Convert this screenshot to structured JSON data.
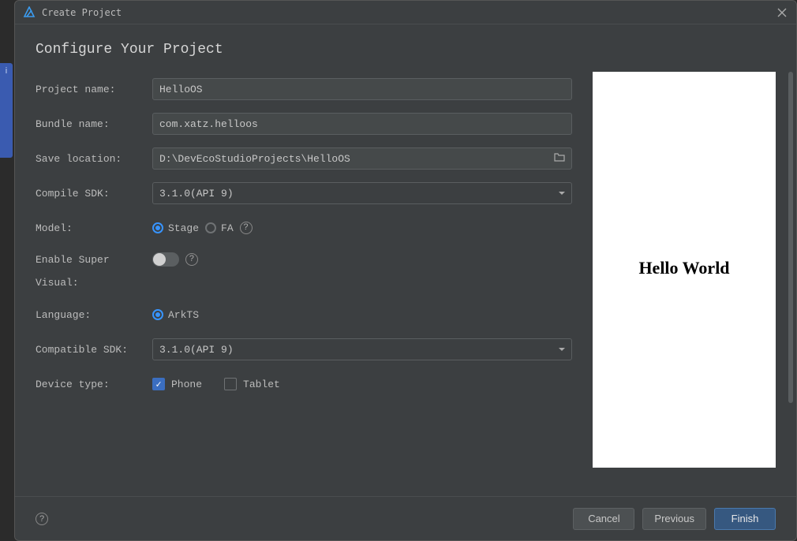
{
  "window": {
    "title": "Create Project"
  },
  "heading": "Configure Your Project",
  "form": {
    "projectName": {
      "label": "Project name:",
      "value": "HelloOS"
    },
    "bundleName": {
      "label": "Bundle name:",
      "value": "com.xatz.helloos"
    },
    "saveLocation": {
      "label": "Save location:",
      "value": "D:\\DevEcoStudioProjects\\HelloOS"
    },
    "compileSdk": {
      "label": "Compile SDK:",
      "value": "3.1.0(API 9)"
    },
    "model": {
      "label": "Model:",
      "options": [
        {
          "label": "Stage",
          "selected": true
        },
        {
          "label": "FA",
          "selected": false
        }
      ]
    },
    "enableSuperVisual": {
      "label1": "Enable Super",
      "label2": "Visual:",
      "on": false
    },
    "language": {
      "label": "Language:",
      "options": [
        {
          "label": "ArkTS",
          "selected": true
        }
      ]
    },
    "compatibleSdk": {
      "label": "Compatible SDK:",
      "value": "3.1.0(API 9)"
    },
    "deviceType": {
      "label": "Device type:",
      "options": [
        {
          "label": "Phone",
          "checked": true
        },
        {
          "label": "Tablet",
          "checked": false
        }
      ]
    }
  },
  "preview": {
    "text": "Hello World"
  },
  "footer": {
    "cancel": "Cancel",
    "previous": "Previous",
    "finish": "Finish"
  },
  "colors": {
    "accent": "#3794ff",
    "primary_btn": "#365880"
  },
  "sideedge": "i"
}
